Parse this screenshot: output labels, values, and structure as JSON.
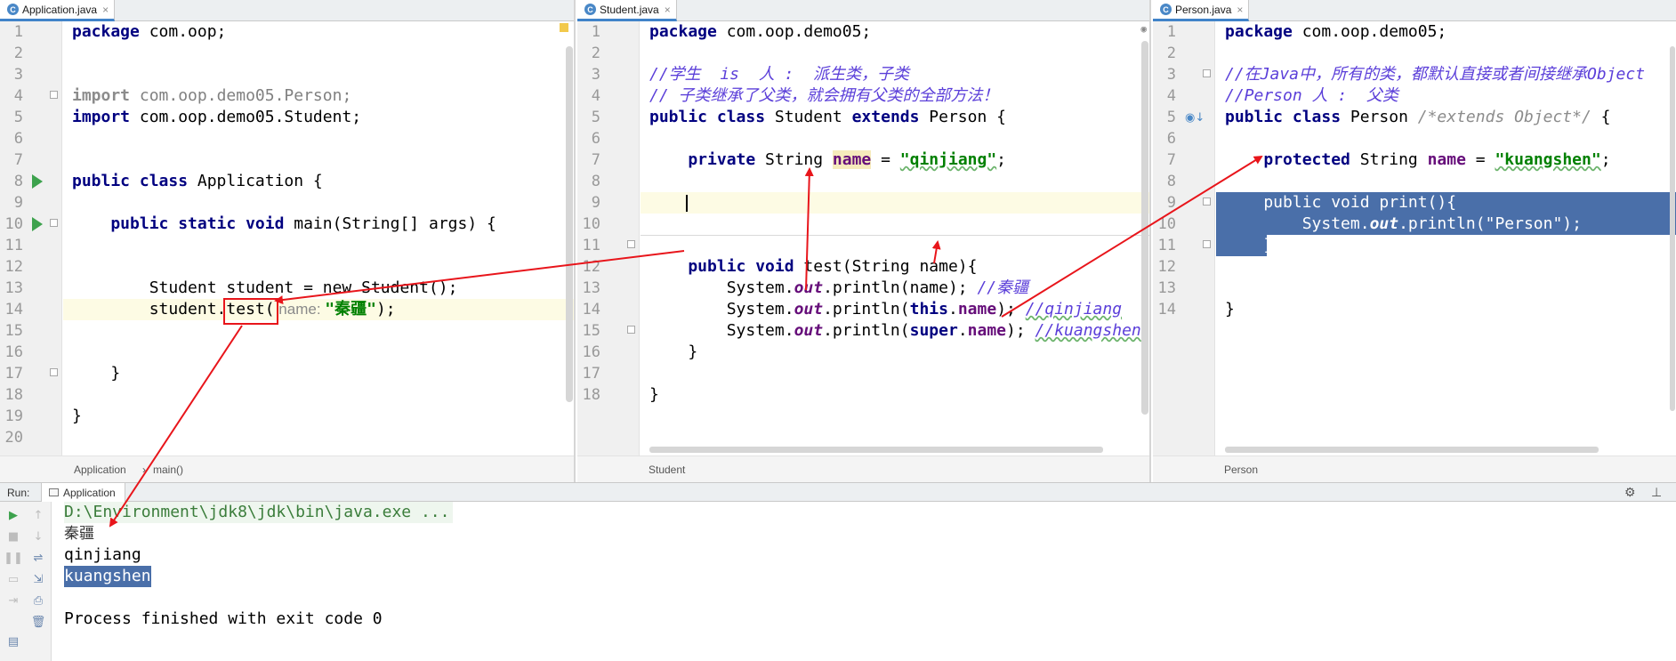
{
  "tabs": {
    "application": {
      "file": "Application.java",
      "icon": "C",
      "close": "×"
    },
    "student": {
      "file": "Student.java",
      "icon": "C",
      "close": "×"
    },
    "person": {
      "file": "Person.java",
      "icon": "C",
      "close": "×"
    }
  },
  "line_numbers": {
    "application": [
      "1",
      "2",
      "3",
      "4",
      "5",
      "6",
      "7",
      "8",
      "9",
      "10",
      "11",
      "12",
      "13",
      "14",
      "15",
      "16",
      "17",
      "18",
      "19",
      "20"
    ],
    "student": [
      "1",
      "2",
      "3",
      "4",
      "5",
      "6",
      "7",
      "8",
      "9",
      "10",
      "11",
      "12",
      "13",
      "14",
      "15",
      "16",
      "17",
      "18"
    ],
    "person": [
      "1",
      "2",
      "3",
      "4",
      "5",
      "6",
      "7",
      "8",
      "9",
      "10",
      "11",
      "12",
      "13",
      "14"
    ]
  },
  "app_code": {
    "l1a": "package",
    "l1b": " com.oop;",
    "l4a": "import",
    "l4b": " com.oop.demo05.Person;",
    "l5a": "import",
    "l5b": " com.oop.demo05.Student;",
    "l8a": "public class",
    "l8b": " Application {",
    "l10a": "    public static void",
    "l10b": " main(String[] args) {",
    "l13": "        Student student = new Student();",
    "l14a": "        student.",
    "l14b": "test(",
    "l14hint": " name: ",
    "l14str": "\"秦疆\"",
    "l14c": ");",
    "l17": "    }",
    "l19": "}"
  },
  "student_code": {
    "l1a": "package",
    "l1b": " com.oop.demo05;",
    "l3": "//学生  is  人 :  派生类，子类",
    "l4": "// 子类继承了父类，就会拥有父类的全部方法！",
    "l5a": "public class",
    "l5b": " Student ",
    "l5c": "extends",
    "l5d": " Person {",
    "l7a": "    private",
    "l7b": " String ",
    "l7c": "name",
    "l7d": " = ",
    "l7e": "\"qinjiang\"",
    "l7f": ";",
    "l11a": "    public void",
    "l11b": " test(String name){",
    "l12a": "        System.",
    "l12b": "out",
    "l12c": ".println(name); ",
    "l12d": "//秦疆",
    "l13a": "        System.",
    "l13b": "out",
    "l13c": ".println(",
    "l13d": "this",
    "l13e": ".",
    "l13f": "name",
    "l13g": "); ",
    "l13h": "//qinjiang",
    "l14a": "        System.",
    "l14b": "out",
    "l14c": ".println(",
    "l14d": "super",
    "l14e": ".",
    "l14f": "name",
    "l14g": "); ",
    "l14h": "//kuangshen",
    "l15": "    }",
    "l17": "}"
  },
  "person_code": {
    "l1a": "package",
    "l1b": " com.oop.demo05;",
    "l3": "//在Java中，所有的类，都默认直接或者间接继承Object",
    "l4": "//Person 人 :  父类",
    "l5a": "public class",
    "l5b": " Person ",
    "l5c": "/*extends Object*/",
    "l5d": " {",
    "l7a": "    protected",
    "l7b": " String ",
    "l7c": "name",
    "l7d": " = ",
    "l7e": "\"kuangshen\"",
    "l7f": ";",
    "l9": "    public void print(){",
    "l10a": "        System.",
    "l10b": "out",
    "l10c": ".println(\"Person\");",
    "l11": "    }",
    "l13": "}"
  },
  "breadcrumbs": {
    "application": [
      "Application",
      "main()"
    ],
    "student": "Student",
    "person": "Person"
  },
  "run": {
    "label": "Run:",
    "tab": "Application",
    "gear": "⚙",
    "minimize": "⊥"
  },
  "console": {
    "command": "D:\\Environment\\jdk8\\jdk\\bin\\java.exe ...",
    "out1": "秦疆",
    "out2": "qinjiang",
    "out3": "kuangshen",
    "finish": "Process finished with exit code 0"
  },
  "colors": {
    "keyword": "#000080",
    "string": "#008000",
    "field": "#660e7a",
    "doc_comment": "#5b3fd9",
    "selection": "#4a6fa9",
    "annotation_arrow": "#e8151b",
    "run_green": "#3da24d"
  }
}
